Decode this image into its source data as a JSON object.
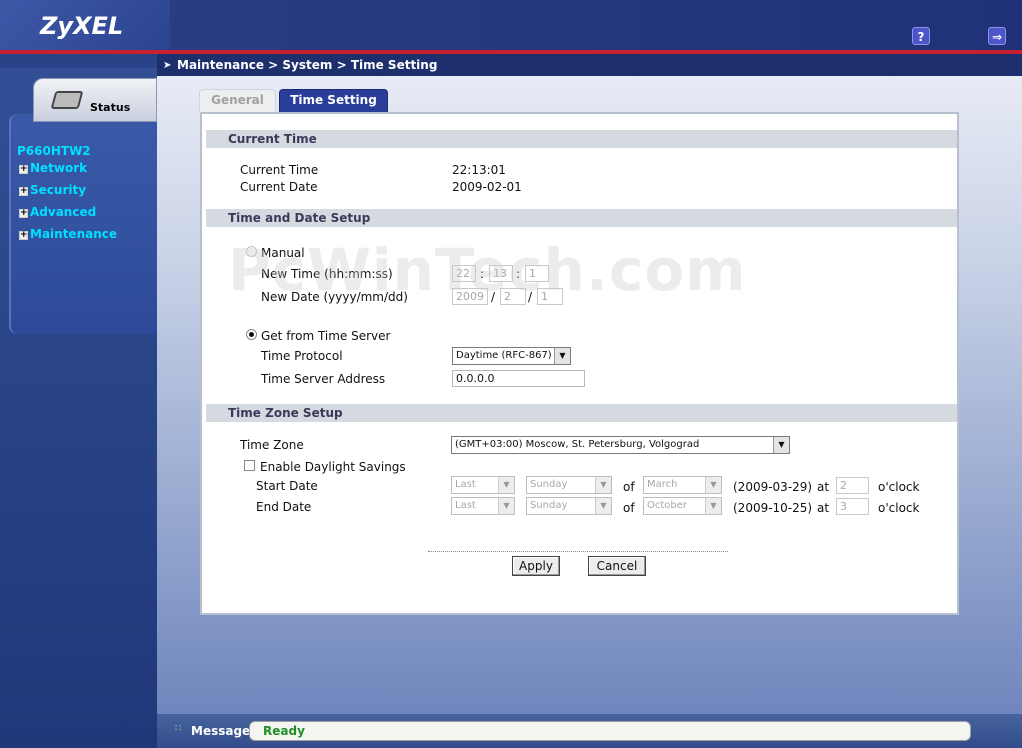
{
  "header": {
    "logo": "ZyXEL",
    "help_icon": "question-icon",
    "logout_icon": "logout-icon"
  },
  "sidebar": {
    "status_label": "Status",
    "model": "P660HTW2",
    "items": [
      {
        "label": "Network"
      },
      {
        "label": "Security"
      },
      {
        "label": "Advanced"
      },
      {
        "label": "Maintenance"
      }
    ]
  },
  "breadcrumb": "Maintenance > System > Time Setting",
  "tabs": {
    "general": "General",
    "time_setting": "Time Setting"
  },
  "current_time": {
    "section_title": "Current Time",
    "time_label": "Current Time",
    "time_value": "22:13:01",
    "date_label": "Current Date",
    "date_value": "2009-02-01"
  },
  "time_date_setup": {
    "section_title": "Time and Date Setup",
    "manual_label": "Manual",
    "new_time_label": "New Time (hh:mm:ss)",
    "new_time": {
      "hh": "22",
      "mm": "13",
      "ss": "1",
      "sep": ":"
    },
    "new_date_label": "New Date (yyyy/mm/dd)",
    "new_date": {
      "yyyy": "2009",
      "mm": "2",
      "dd": "1",
      "sep": "/"
    },
    "server_label": "Get from Time Server",
    "protocol_label": "Time Protocol",
    "protocol_value": "Daytime (RFC-867)",
    "server_address_label": "Time Server Address",
    "server_address_value": "0.0.0.0"
  },
  "time_zone_setup": {
    "section_title": "Time Zone Setup",
    "zone_label": "Time Zone",
    "zone_value": "(GMT+03:00) Moscow, St. Petersburg, Volgograd",
    "dst_label": "Enable Daylight Savings",
    "start_label": "Start Date",
    "start": {
      "week": "Last",
      "day": "Sunday",
      "of": "of",
      "month": "March",
      "computed": "(2009-03-29)",
      "at": "at",
      "hour": "2",
      "oclock": "o'clock"
    },
    "end_label": "End Date",
    "end": {
      "week": "Last",
      "day": "Sunday",
      "of": "of",
      "month": "October",
      "computed": "(2009-10-25)",
      "at": "at",
      "hour": "3",
      "oclock": "o'clock"
    }
  },
  "actions": {
    "apply": "Apply",
    "cancel": "Cancel"
  },
  "watermark": "PcWinTech.com",
  "statusbar": {
    "label": "Message",
    "text": "Ready"
  }
}
